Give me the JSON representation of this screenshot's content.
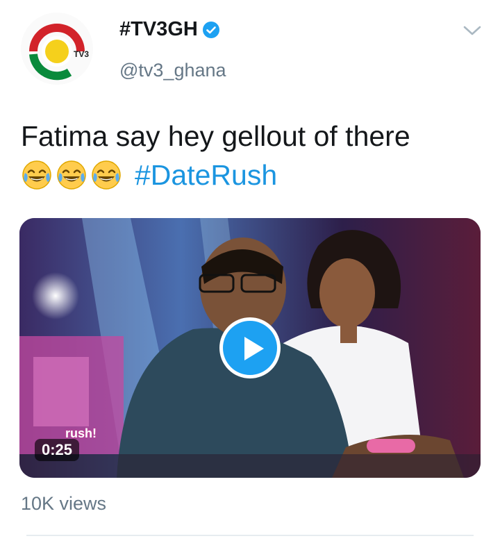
{
  "tweet": {
    "display_name": "#TV3GH",
    "handle": "@tv3_ghana",
    "text_line1": "Fatima say hey gellout of there",
    "emoji_count": 3,
    "emoji_name": "face-with-tears-of-joy",
    "hashtag": "#DateRush",
    "verified": true
  },
  "avatar": {
    "logo_label": "TV3"
  },
  "media": {
    "duration": "0:25",
    "overlay_logo_text": "rush!"
  },
  "stats": {
    "views": "10K views"
  },
  "colors": {
    "accent": "#1da1f2",
    "hashtag": "#1b95e0",
    "muted": "#657786"
  }
}
